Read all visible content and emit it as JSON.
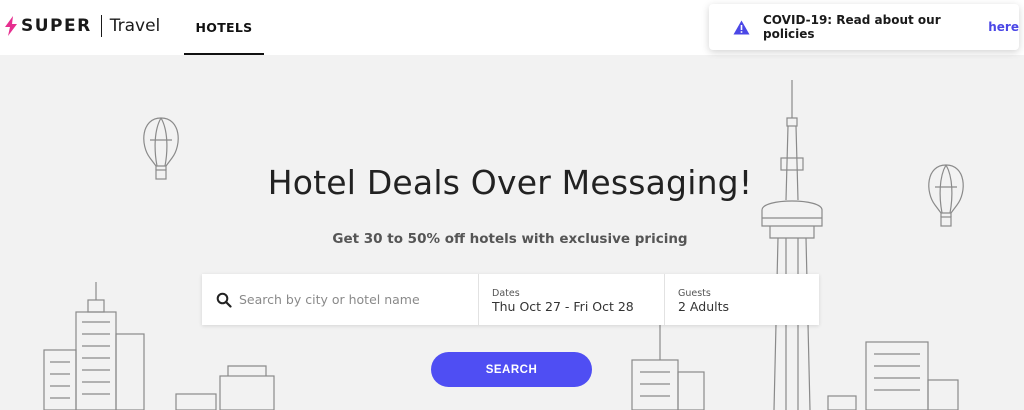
{
  "brand": {
    "name_bold": "SUPER",
    "name_light": "Travel",
    "accent": "#e62e8f"
  },
  "nav": {
    "tabs": [
      {
        "label": "HOTELS",
        "active": true
      }
    ]
  },
  "notice": {
    "text": "COVID-19: Read about our policies",
    "link_text": "here",
    "link_color": "#4b47e6",
    "icon": "warning-triangle-icon"
  },
  "hero": {
    "title": "Hotel Deals Over Messaging!",
    "subtitle": "Get 30 to 50% off hotels with exclusive pricing"
  },
  "search": {
    "destination_placeholder": "Search by city or hotel name",
    "dates_label": "Dates",
    "dates_value": "Thu Oct 27 - Fri Oct 28",
    "guests_label": "Guests",
    "guests_value": "2 Adults",
    "button_label": "SEARCH",
    "button_color": "#4f4ef3"
  }
}
